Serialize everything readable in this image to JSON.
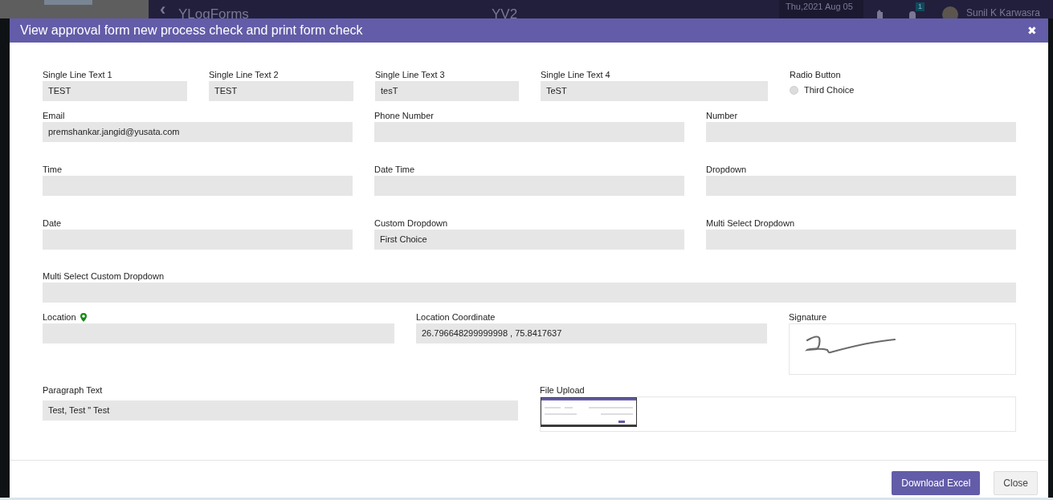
{
  "app_header": {
    "back_icon": "‹",
    "title": "YLogForms",
    "center_text": "YV2",
    "date": "Thu,2021 Aug 05",
    "notification_count": "1",
    "user_name": "Sunil K Karwasra"
  },
  "modal": {
    "title": "View approval form new process check and print form check",
    "close": "✖",
    "fields": [
      {
        "kind": "text",
        "label": "Single Line Text 1",
        "value": "TEST"
      },
      {
        "kind": "text",
        "label": "Single Line Text 2",
        "value": "TEST"
      },
      {
        "kind": "text",
        "label": "Single Line Text 3",
        "value": "tesT"
      },
      {
        "kind": "text",
        "label": "Single Line Text 4",
        "value": "TeST"
      },
      {
        "kind": "radio",
        "label": "Radio Button",
        "option": "Third Choice",
        "checked": false
      },
      {
        "kind": "text",
        "label": "Email",
        "value": "premshankar.jangid@yusata.com"
      },
      {
        "kind": "text",
        "label": "Phone Number"
      },
      {
        "kind": "text",
        "label": "Number"
      },
      {
        "kind": "text",
        "label": "Time"
      },
      {
        "kind": "text",
        "label": "Date Time"
      },
      {
        "kind": "text",
        "label": "Dropdown"
      },
      {
        "kind": "text",
        "label": "Date"
      },
      {
        "kind": "text",
        "label": "Custom Dropdown",
        "value": "First Choice"
      },
      {
        "kind": "text",
        "label": "Multi Select Dropdown"
      },
      {
        "kind": "text",
        "label": "Multi Select Custom Dropdown"
      },
      {
        "kind": "location",
        "label": "Location"
      },
      {
        "kind": "text",
        "label": "Location Coordinate",
        "value": "26.796648299999998 , 75.8417637"
      },
      {
        "kind": "signature",
        "label": "Signature"
      },
      {
        "kind": "text",
        "label": "Paragraph Text",
        "value": "Test, Test \" Test"
      },
      {
        "kind": "file",
        "label": "File Upload"
      }
    ],
    "buttons": [
      {
        "kind": "primary",
        "label": "Download Excel"
      },
      {
        "kind": "secondary",
        "label": "Close"
      }
    ]
  }
}
